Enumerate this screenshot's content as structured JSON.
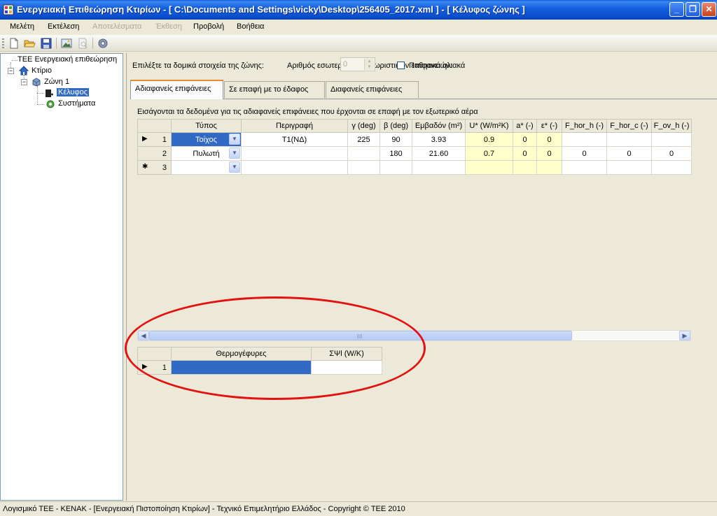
{
  "window": {
    "title": "Ενεργειακή Επιθεώρηση Κτιρίων - [ C:\\Documents and Settings\\vicky\\Desktop\\256405_2017.xml ] - [ Κέλυφος ζώνης ]",
    "minimize": "_",
    "maximize": "❐",
    "close": "✕"
  },
  "menu": {
    "items": [
      {
        "label": "Μελέτη",
        "enabled": true
      },
      {
        "label": "Εκτέλεση",
        "enabled": true
      },
      {
        "label": "Αποτελέσματα",
        "enabled": false
      },
      {
        "label": "Έκθεση",
        "enabled": false
      },
      {
        "label": "Προβολή",
        "enabled": true
      },
      {
        "label": "Βοήθεια",
        "enabled": true
      }
    ]
  },
  "toolbar": {
    "icons": [
      "new-file-icon",
      "open-folder-icon",
      "save-icon",
      "image-icon",
      "print-preview-icon",
      "settings-icon"
    ]
  },
  "tree": {
    "root": "ΤΕΕ Ενεργειακή επιθεώρηση",
    "building": "Κτίριο",
    "zone": "Ζώνη 1",
    "envelope": "Κέλυφος",
    "systems": "Συστήματα"
  },
  "zone_panel": {
    "select_label": "Επιλέξτε τα δομικά στοιχεία της ζώνης:",
    "internal_surfaces_label": "Αριθμός εσωτερικών διαχωριστικών επιφανειών:",
    "internal_surfaces_value": "0",
    "passive_solar_label": "Παθητικά ηλιακά",
    "passive_solar_checked": false
  },
  "tabs": [
    {
      "label": "Αδιαφανείς επιφάνειες",
      "active": true
    },
    {
      "label": "Σε επαφή με το έδαφος",
      "active": false
    },
    {
      "label": "Διαφανείς επιφάνειες",
      "active": false
    }
  ],
  "grid_caption": "Εισάγονται τα δεδομένα για τις αδιαφανείς επιφάνειες που έρχονται σε επαφή με τον εξωτερικό αέρα",
  "opaque_grid": {
    "columns": [
      "Τύπος",
      "Περιγραφή",
      "γ (deg)",
      "β (deg)",
      "Εμβαδόν (m²)",
      "U* (W/m²K)",
      "a* (-)",
      "ε* (-)",
      "F_hor_h (-)",
      "F_hor_c (-)",
      "F_ov_h (-)"
    ],
    "rows": [
      {
        "num": "1",
        "indicator": "▶",
        "type": "Τοίχος",
        "desc": "T1(ΝΔ)",
        "gamma": "225",
        "beta": "90",
        "area": "3.93",
        "u": "0.9",
        "a": "0",
        "e": "0",
        "fhh": "",
        "fhc": "",
        "foh": ""
      },
      {
        "num": "2",
        "indicator": "",
        "type": "Πυλωτή",
        "desc": "",
        "gamma": "",
        "beta": "180",
        "area": "21.60",
        "u": "0.7",
        "a": "0",
        "e": "0",
        "fhh": "0",
        "fhc": "0",
        "foh": "0"
      },
      {
        "num": "3",
        "indicator": "✱",
        "type": "",
        "desc": "",
        "gamma": "",
        "beta": "",
        "area": "",
        "u": "",
        "a": "",
        "e": "",
        "fhh": "",
        "fhc": "",
        "foh": ""
      }
    ]
  },
  "bridges_grid": {
    "columns": [
      "Θερμογέφυρες",
      "ΣΨl (W/K)"
    ],
    "rows": [
      {
        "num": "1",
        "indicator": "▶",
        "bridge": "",
        "value": ""
      }
    ]
  },
  "status_bar": "Λογισμικό ΤΕΕ - ΚΕΝΑΚ  -  [Ενεργειακή Πιστοποίηση Κτιρίων]  -  Τεχνικό Επιμελητήριο Ελλάδος  -  Copyright © ΤΕΕ 2010"
}
